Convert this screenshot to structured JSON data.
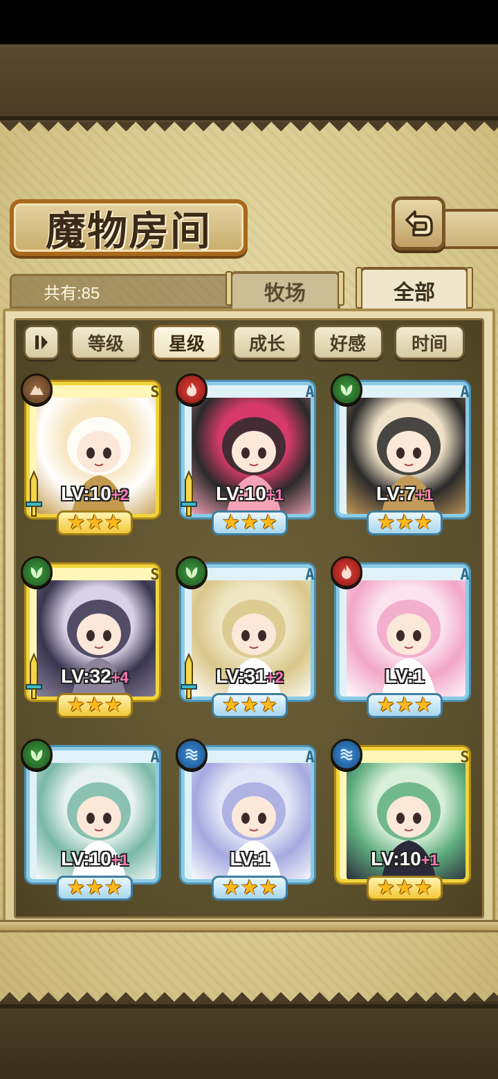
{
  "header": {
    "title": "魔物房间",
    "back_icon": "back-arrow-icon"
  },
  "summary": {
    "count_label": "共有:85"
  },
  "tabs": [
    {
      "label": "牧场",
      "active": false
    },
    {
      "label": "全部",
      "active": true
    }
  ],
  "sort": {
    "toggle_icon": "pause-sort-icon",
    "options": [
      {
        "label": "等级",
        "active": false
      },
      {
        "label": "星级",
        "active": true
      },
      {
        "label": "成长",
        "active": false
      },
      {
        "label": "好感",
        "active": false
      },
      {
        "label": "时间",
        "active": false
      }
    ]
  },
  "monsters": [
    {
      "rank": "S",
      "element": "earth",
      "level": "LV:10",
      "bonus": "+2",
      "stars": "★★★",
      "equipped": true,
      "palette": [
        "#f7e6c0",
        "#ffffff",
        "#c49a4e"
      ]
    },
    {
      "rank": "A",
      "element": "fire",
      "level": "LV:10",
      "bonus": "+1",
      "stars": "★★★",
      "equipped": true,
      "palette": [
        "#d63a6a",
        "#2a2a2a",
        "#f4a3b7"
      ]
    },
    {
      "rank": "A",
      "element": "leaf",
      "level": "LV:7",
      "bonus": "+1",
      "stars": "★★★",
      "equipped": false,
      "palette": [
        "#f0e2c8",
        "#2a2a2a",
        "#c49a5a"
      ]
    },
    {
      "rank": "S",
      "element": "leaf",
      "level": "LV:32",
      "bonus": "+4",
      "stars": "★★★",
      "equipped": true,
      "palette": [
        "#d9d2e6",
        "#3a3550",
        "#8a8399"
      ]
    },
    {
      "rank": "A",
      "element": "leaf",
      "level": "LV:31",
      "bonus": "+2",
      "stars": "★★★",
      "equipped": true,
      "palette": [
        "#efe6c4",
        "#d9c78a",
        "#ffffff"
      ]
    },
    {
      "rank": "A",
      "element": "fire",
      "level": "LV:1",
      "bonus": "",
      "stars": "★★★",
      "equipped": false,
      "palette": [
        "#fbe3ee",
        "#f2a6c8",
        "#ffffff"
      ]
    },
    {
      "rank": "A",
      "element": "leaf",
      "level": "LV:10",
      "bonus": "+1",
      "stars": "★★★",
      "equipped": false,
      "palette": [
        "#e6f2ef",
        "#79b8a6",
        "#ffffff"
      ]
    },
    {
      "rank": "A",
      "element": "water",
      "level": "LV:1",
      "bonus": "",
      "stars": "★★★",
      "equipped": false,
      "palette": [
        "#e3e6f6",
        "#a4a9e0",
        "#ffffff"
      ]
    },
    {
      "rank": "S",
      "element": "water",
      "level": "LV:10",
      "bonus": "+1",
      "stars": "★★★",
      "equipped": false,
      "palette": [
        "#d8efd9",
        "#5fae7f",
        "#2a2a3a"
      ]
    }
  ]
}
